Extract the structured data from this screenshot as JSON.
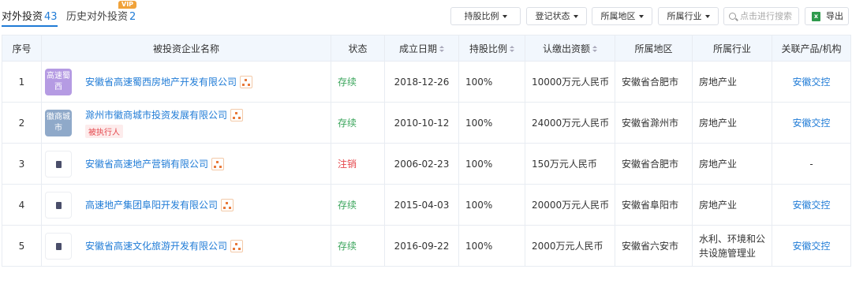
{
  "tabs": {
    "active": {
      "label": "对外投资",
      "count": "43"
    },
    "history": {
      "label": "历史对外投资",
      "count": "2",
      "badge": "VIP"
    }
  },
  "filters": [
    "持股比例",
    "登记状态",
    "所属地区",
    "所属行业"
  ],
  "search": {
    "placeholder": "点击进行搜索"
  },
  "export_label": "导出",
  "columns": [
    "序号",
    "被投资企业名称",
    "状态",
    "成立日期",
    "持股比例",
    "认缴出资额",
    "所属地区",
    "所属行业",
    "关联产品/机构"
  ],
  "rows": [
    {
      "no": "1",
      "logo": "高速蜀西",
      "name": "安徽省高速蜀西房地产开发有限公司",
      "tag": "",
      "status": "存续",
      "date": "2018-12-26",
      "ratio": "100%",
      "capital": "10000万元人民币",
      "region": "安徽省合肥市",
      "industry": "房地产业",
      "related": "安徽交控"
    },
    {
      "no": "2",
      "logo": "徽商城市",
      "name": "滁州市徽商城市投资发展有限公司",
      "tag": "被执行人",
      "status": "存续",
      "date": "2010-10-12",
      "ratio": "100%",
      "capital": "24000万元人民币",
      "region": "安徽省滁州市",
      "industry": "房地产业",
      "related": "安徽交控"
    },
    {
      "no": "3",
      "logo": "",
      "name": "安徽省高速地产营销有限公司",
      "tag": "",
      "status": "注销",
      "date": "2006-02-23",
      "ratio": "100%",
      "capital": "150万元人民币",
      "region": "安徽省合肥市",
      "industry": "房地产业",
      "related": "-"
    },
    {
      "no": "4",
      "logo": "",
      "name": "高速地产集团阜阳开发有限公司",
      "tag": "",
      "status": "存续",
      "date": "2015-04-03",
      "ratio": "100%",
      "capital": "20000万元人民币",
      "region": "安徽省阜阳市",
      "industry": "房地产业",
      "related": "安徽交控"
    },
    {
      "no": "5",
      "logo": "",
      "name": "安徽省高速文化旅游开发有限公司",
      "tag": "",
      "status": "存续",
      "date": "2016-09-22",
      "ratio": "100%",
      "capital": "2000万元人民币",
      "region": "安徽省六安市",
      "industry": "水利、环境和公共设施管理业",
      "related": "安徽交控"
    }
  ],
  "colors": {
    "accent": "#1f7bd6",
    "status_active": "#3ba55c",
    "status_cancelled": "#e5484d",
    "header_bg": "#f2f7fd"
  }
}
